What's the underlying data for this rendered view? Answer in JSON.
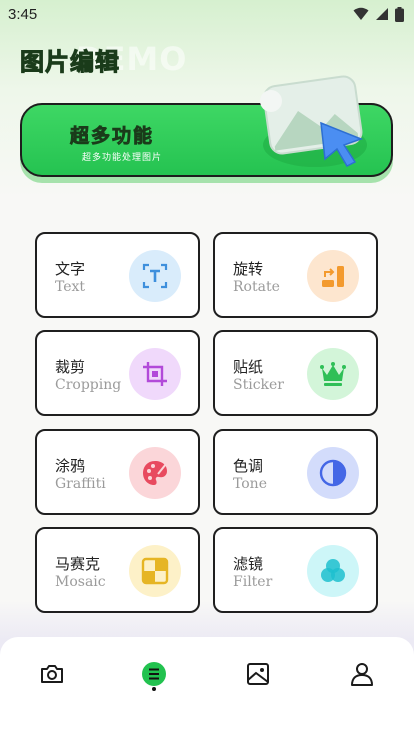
{
  "status_bar": {
    "time": "3:45"
  },
  "header": {
    "title": "图片编辑",
    "watermark": "DEMO"
  },
  "banner": {
    "title": "超多功能",
    "subtitle": "超多功能处理图片"
  },
  "tools": [
    {
      "cn": "文字",
      "en": "Text",
      "icon": "text-icon",
      "bg": "#d9ecfb",
      "color": "#3e8fdc"
    },
    {
      "cn": "旋转",
      "en": "Rotate",
      "icon": "rotate-icon",
      "bg": "#fde6cf",
      "color": "#f39a2e"
    },
    {
      "cn": "裁剪",
      "en": "Cropping",
      "icon": "crop-icon",
      "bg": "#f0d9fb",
      "color": "#b24ad9"
    },
    {
      "cn": "贴纸",
      "en": "Sticker",
      "icon": "crown-icon",
      "bg": "#d3f5d9",
      "color": "#2fbf57"
    },
    {
      "cn": "涂鸦",
      "en": "Graffiti",
      "icon": "palette-icon",
      "bg": "#fbd6d9",
      "color": "#e84a5f"
    },
    {
      "cn": "色调",
      "en": "Tone",
      "icon": "tone-icon",
      "bg": "#d3dcfb",
      "color": "#4467e6"
    },
    {
      "cn": "马赛克",
      "en": "Mosaic",
      "icon": "mosaic-icon",
      "bg": "#fdf1c8",
      "color": "#e6b524"
    },
    {
      "cn": "滤镜",
      "en": "Filter",
      "icon": "filter-icon",
      "bg": "#cdf6f8",
      "color": "#1fbfcf"
    }
  ],
  "bottom_nav": {
    "items": [
      {
        "icon": "camera-icon",
        "active": false
      },
      {
        "icon": "menu-icon",
        "active": true
      },
      {
        "icon": "image-icon",
        "active": false
      },
      {
        "icon": "user-icon",
        "active": false
      }
    ],
    "accent": "#22c24f"
  }
}
